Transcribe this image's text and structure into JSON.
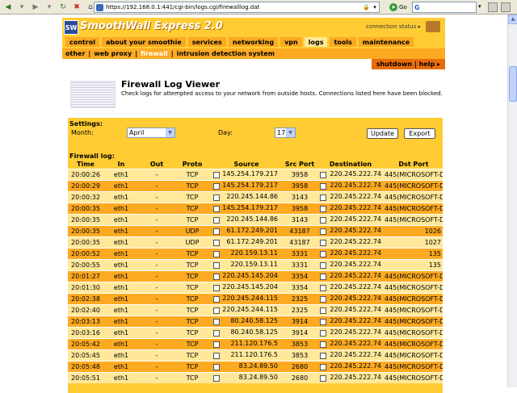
{
  "browser": {
    "url": "https://192.168.0.1:441/cgi-bin/logs.cgi/firewalllog.dat",
    "go_label": "Go",
    "search_logo": "G"
  },
  "header": {
    "brand": "SmoothWall Express 2.0",
    "connection_status": "connection status ▸"
  },
  "nav": {
    "tabs": [
      "control",
      "about your smoothie",
      "services",
      "networking",
      "vpn",
      "logs",
      "tools",
      "maintenance"
    ],
    "active": "logs",
    "sub": [
      "other",
      "web proxy",
      "firewall",
      "intrusion detection system"
    ],
    "active_sub": "firewall",
    "shutdown": "shutdown | help ▸"
  },
  "page": {
    "title": "Firewall Log Viewer",
    "subtitle": "Check logs for attempted access to your network from outside hosts. Connections listed here have been blocked."
  },
  "settings": {
    "label": "Settings:",
    "month_label": "Month:",
    "month_value": "April",
    "day_label": "Day:",
    "day_value": "17",
    "update": "Update",
    "export": "Export"
  },
  "log": {
    "label": "Firewall log:",
    "columns": [
      "Time",
      "In",
      "Out",
      "Proto",
      "Source",
      "Src Port",
      "Destination",
      "Dst Port"
    ],
    "rows": [
      [
        "20:00:26",
        "eth1",
        "-",
        "TCP",
        "145.254.179.217",
        "3958",
        "220.245.222.74",
        "445(MICROSOFT-DS)"
      ],
      [
        "20:00:29",
        "eth1",
        "-",
        "TCP",
        "145.254.179.217",
        "3958",
        "220.245.222.74",
        "445(MICROSOFT-DS)"
      ],
      [
        "20:00:32",
        "eth1",
        "-",
        "TCP",
        "220.245.144.86",
        "3143",
        "220.245.222.74",
        "445(MICROSOFT-DS)"
      ],
      [
        "20:00:35",
        "eth1",
        "-",
        "TCP",
        "145.254.179.217",
        "3958",
        "220.245.222.74",
        "445(MICROSOFT-DS)"
      ],
      [
        "20:00:35",
        "eth1",
        "-",
        "TCP",
        "220.245.144.86",
        "3143",
        "220.245.222.74",
        "445(MICROSOFT-DS)"
      ],
      [
        "20:00:35",
        "eth1",
        "-",
        "UDP",
        "61.172.249.201",
        "43187",
        "220.245.222.74",
        "1026"
      ],
      [
        "20:00:35",
        "eth1",
        "-",
        "UDP",
        "61.172.249.201",
        "43187",
        "220.245.222.74",
        "1027"
      ],
      [
        "20:00:52",
        "eth1",
        "-",
        "TCP",
        "220.159.13.11",
        "3331",
        "220.245.222.74",
        "135"
      ],
      [
        "20:00:55",
        "eth1",
        "-",
        "TCP",
        "220.159.13.11",
        "3331",
        "220.245.222.74",
        "135"
      ],
      [
        "20:01:27",
        "eth1",
        "-",
        "TCP",
        "220.245.145.204",
        "3354",
        "220.245.222.74",
        "445(MICROSOFT-DS)"
      ],
      [
        "20:01:30",
        "eth1",
        "-",
        "TCP",
        "220.245.145.204",
        "3354",
        "220.245.222.74",
        "445(MICROSOFT-DS)"
      ],
      [
        "20:02:38",
        "eth1",
        "-",
        "TCP",
        "220.245.244.115",
        "2325",
        "220.245.222.74",
        "445(MICROSOFT-DS)"
      ],
      [
        "20:02:40",
        "eth1",
        "-",
        "TCP",
        "220.245.244.115",
        "2325",
        "220.245.222.74",
        "445(MICROSOFT-DS)"
      ],
      [
        "20:03:13",
        "eth1",
        "-",
        "TCP",
        "80.240.58.125",
        "3914",
        "220.245.222.74",
        "445(MICROSOFT-DS)"
      ],
      [
        "20:03:16",
        "eth1",
        "-",
        "TCP",
        "80.240.58.125",
        "3914",
        "220.245.222.74",
        "445(MICROSOFT-DS)"
      ],
      [
        "20:05:42",
        "eth1",
        "-",
        "TCP",
        "211.120.176.5",
        "3853",
        "220.245.222.74",
        "445(MICROSOFT-DS)"
      ],
      [
        "20:05:45",
        "eth1",
        "-",
        "TCP",
        "211.120.176.5",
        "3853",
        "220.245.222.74",
        "445(MICROSOFT-DS)"
      ],
      [
        "20:05:48",
        "eth1",
        "-",
        "TCP",
        "83.24.89.50",
        "2680",
        "220.245.222.74",
        "445(MICROSOFT-DS)"
      ],
      [
        "20:05:51",
        "eth1",
        "-",
        "TCP",
        "83.24.89.50",
        "2680",
        "220.245.222.74",
        "445(MICROSOFT-DS)"
      ]
    ]
  }
}
